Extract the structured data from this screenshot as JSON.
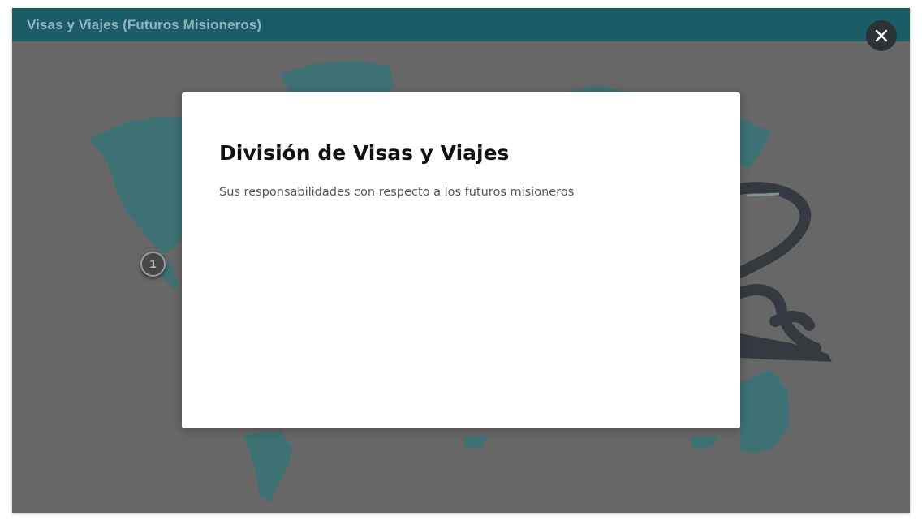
{
  "window": {
    "title": "Visas y Viajes (Futuros Misioneros)"
  },
  "hotspot": {
    "number": "1"
  },
  "close_button": {
    "icon": "close-icon"
  },
  "modal": {
    "title": "División de Visas y Viajes",
    "subtitle": "Sus responsabilidades con respecto a los futuros misioneros"
  },
  "colors": {
    "titlebar": "#1a5d67",
    "map_land": "#2f7f82",
    "background": "#6f6f6f",
    "airplane": "#222a35",
    "modal": "#ffffff"
  }
}
